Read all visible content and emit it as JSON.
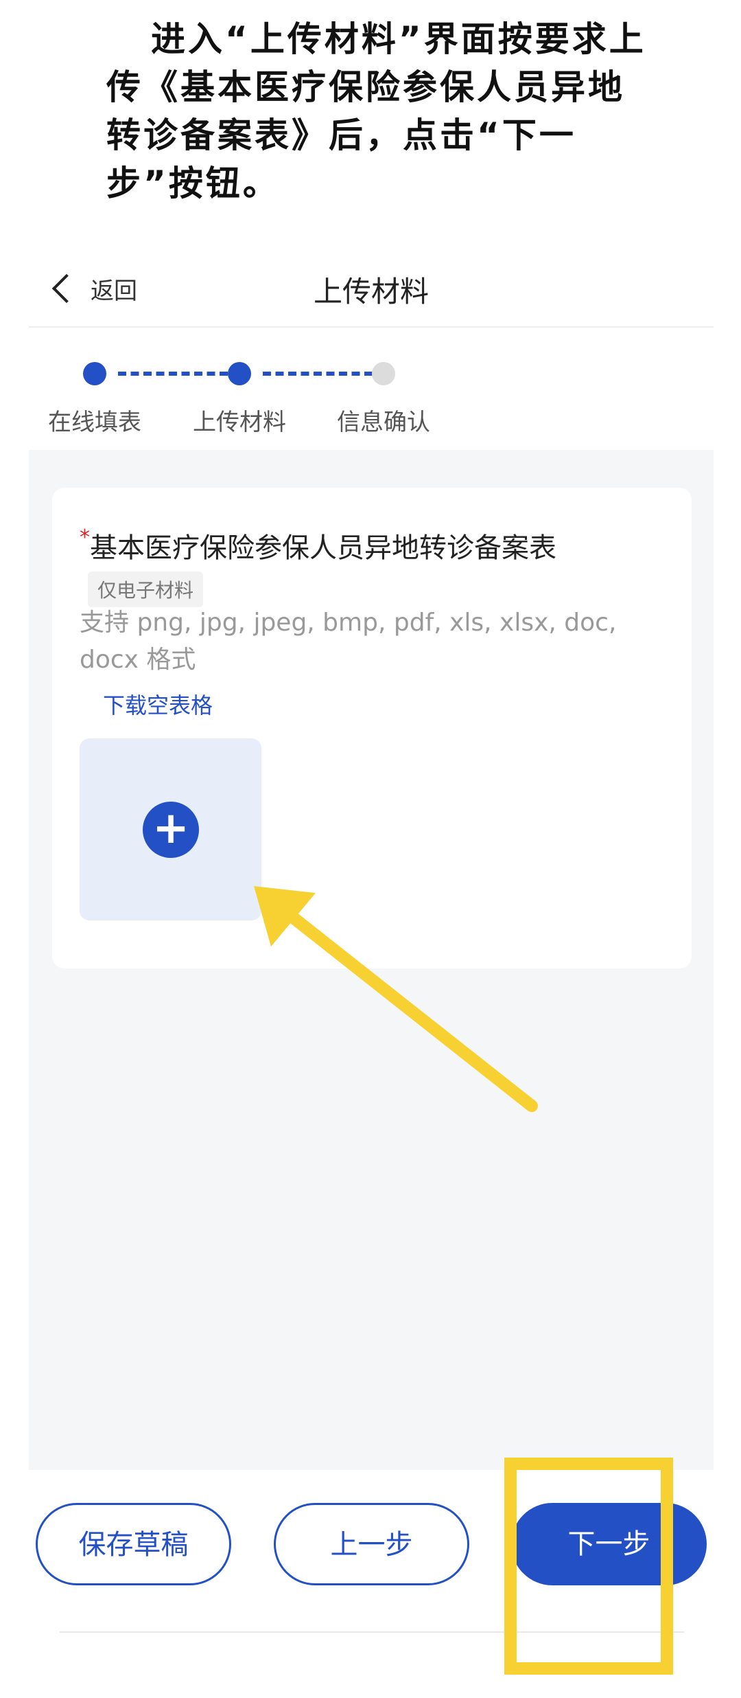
{
  "instruction": "进入“上传材料”界面按要求上传《基本医疗保险参保人员异地转诊备案表》后，点击“下一步”按钮。",
  "navbar": {
    "back_label": "返回",
    "title": "上传材料"
  },
  "steps": [
    {
      "label": "在线填表",
      "state": "done"
    },
    {
      "label": "上传材料",
      "state": "current"
    },
    {
      "label": "信息确认",
      "state": "todo"
    }
  ],
  "upload_card": {
    "required_mark": "*",
    "title": "基本医疗保险参保人员异地转诊备案表",
    "tag": "仅电子材料",
    "hint": "支持 png, jpg, jpeg, bmp, pdf, xls, xlsx, doc, docx 格式",
    "download_link": "下载空表格",
    "add_icon": "plus-icon"
  },
  "footer": {
    "save_draft": "保存草稿",
    "prev": "上一步",
    "next": "下一步"
  },
  "colors": {
    "primary": "#2350c4",
    "annotation": "#f7d132",
    "background": "#f5f6f8"
  }
}
